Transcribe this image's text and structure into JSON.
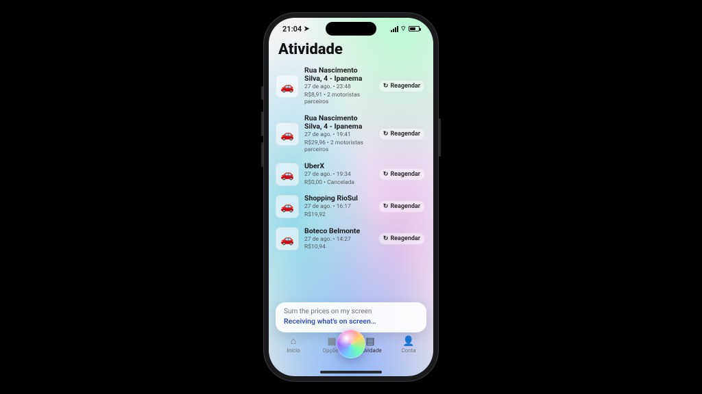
{
  "status": {
    "time": "21:04"
  },
  "header": {
    "title": "Atividade"
  },
  "rebook_label": "Reagendar",
  "rides": [
    {
      "title": "Rua Nascimento Silva, 4 - Ipanema",
      "line1": "27 de ago. • 23:48",
      "line2": "R$8,91 • 2 motoristas parceiros"
    },
    {
      "title": "Rua Nascimento Silva, 4 - Ipanema",
      "line1": "27 de ago. • 19:41",
      "line2": "R$29,96 • 2 motoristas parceiros"
    },
    {
      "title": "UberX",
      "line1": "27 de ago. • 19:34",
      "line2": "R$0,00 • Cancelada"
    },
    {
      "title": "Shopping RioSul",
      "line1": "27 de ago. • 16:17",
      "line2": "R$19,92"
    },
    {
      "title": "Boteco Belmonte",
      "line1": "27 de ago. • 14:27",
      "line2": "R$10,94"
    }
  ],
  "siri": {
    "query": "Sum the prices on my screen",
    "status": "Receiving what's on screen…"
  },
  "tabs": {
    "home": "Início",
    "options": "Opções",
    "activity": "Atividade",
    "account": "Conta"
  }
}
